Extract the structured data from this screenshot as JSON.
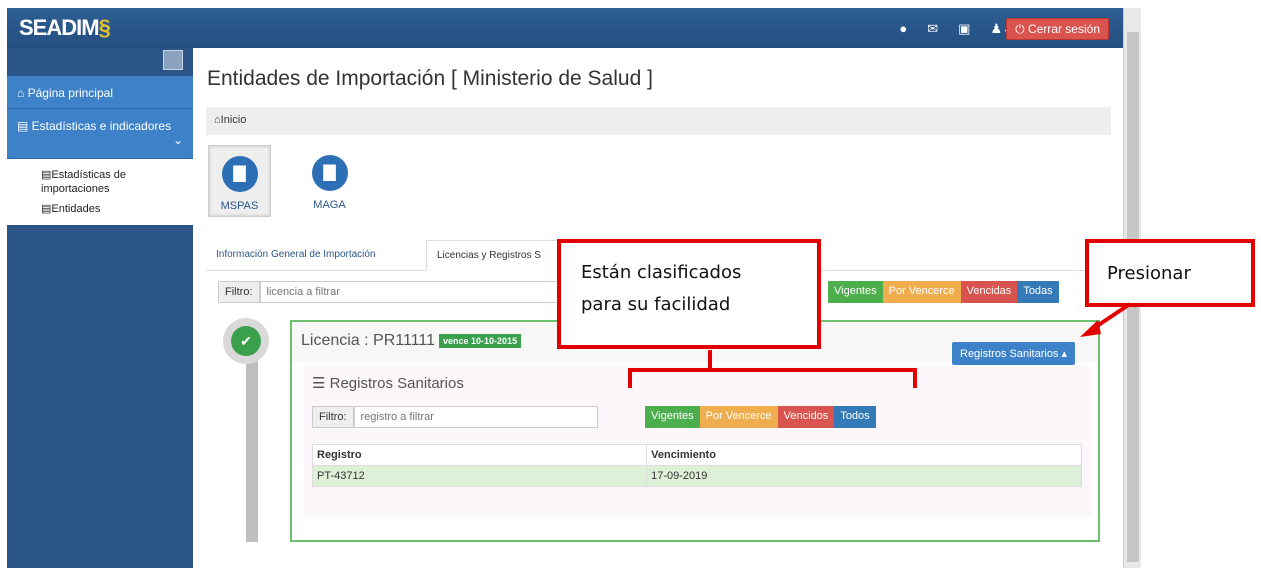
{
  "app": {
    "logo": "SEADIM",
    "logo_mark": "§"
  },
  "header": {
    "icons": [
      "chat-icon",
      "mail-icon",
      "money-icon",
      "user-icon"
    ],
    "logout_label": "Cerrar sesión"
  },
  "sidebar": {
    "items": [
      {
        "label": "Página principal"
      },
      {
        "label": "Estadísticas e indicadores"
      }
    ],
    "subitems": [
      {
        "label": "Estadísticas de importaciones"
      },
      {
        "label": "Entidades"
      }
    ]
  },
  "page": {
    "title": "Entidades de Importación [ Ministerio de Salud ]",
    "breadcrumb": "Inicio"
  },
  "entities": [
    {
      "label": "MSPAS"
    },
    {
      "label": "MAGA"
    }
  ],
  "tabs": [
    {
      "label": "Información General de Importación"
    },
    {
      "label": "Licencias y Registros S"
    }
  ],
  "license_filter": {
    "label": "Filtro:",
    "placeholder": "licencia a filtrar",
    "buttons": [
      "Vigentes",
      "Por Vencerce",
      "Vencidas",
      "Todas"
    ]
  },
  "license": {
    "title": "Licencia : PR11111",
    "badge": "vence 10-10-2015",
    "toggle_label": "Registros Sanitarios"
  },
  "records": {
    "title": "Registros Sanitarios",
    "filter_label": "Filtro:",
    "placeholder": "registro a filtrar",
    "buttons": [
      "Vigentes",
      "Por Vencerce",
      "Vencidos",
      "Todos"
    ],
    "columns": [
      "Registro",
      "Vencimiento"
    ],
    "rows": [
      [
        "PT-43712",
        "17-09-2019"
      ]
    ]
  },
  "annotations": {
    "box1_line1": "Están clasificados",
    "box1_line2": "para su facilidad",
    "box2": "Presionar"
  },
  "colors": {
    "header": "#2b5587",
    "active": "#3d82c9",
    "success": "#4cae4c",
    "warning": "#f0ad4e",
    "danger": "#d9534f",
    "primary": "#337ab7",
    "annotation": "#e30000"
  }
}
